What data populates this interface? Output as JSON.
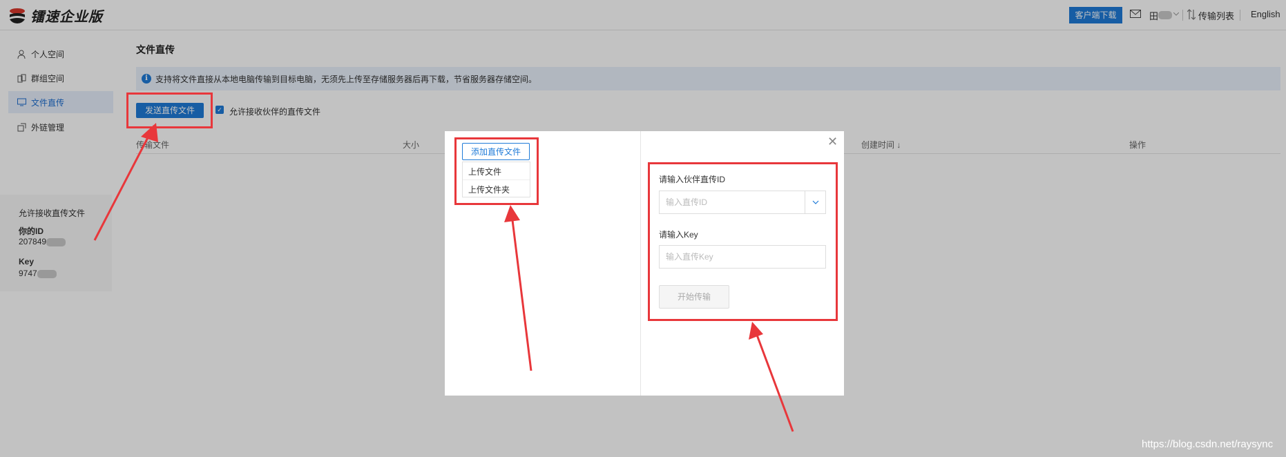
{
  "header": {
    "logo_text": "镭速企业版",
    "download_button": "客户端下载",
    "user_name": "田",
    "transfer_list": "传输列表",
    "language": "English"
  },
  "sidebar": {
    "items": [
      {
        "label": "个人空间",
        "icon": "person-icon"
      },
      {
        "label": "群组空间",
        "icon": "group-icon"
      },
      {
        "label": "文件直传",
        "icon": "monitor-icon"
      },
      {
        "label": "外链管理",
        "icon": "link-icon"
      }
    ],
    "info_title": "允许接收直传文件",
    "id_label": "你的ID",
    "id_value": "207849",
    "key_label": "Key",
    "key_value": "9747"
  },
  "main": {
    "title": "文件直传",
    "notice": "支持将文件直接从本地电脑传输到目标电脑，无须先上传至存储服务器后再下载，节省服务器存储空间。",
    "send_button": "发送直传文件",
    "allow_checkbox_label": "允许接收伙伴的直传文件",
    "allow_checked": true,
    "columns": [
      "传输文件",
      "大小",
      "创建时间 ↓",
      "操作"
    ]
  },
  "modal": {
    "add_button": "添加直传文件",
    "menu": [
      "上传文件",
      "上传文件夹"
    ],
    "partner_id_label": "请输入伙伴直传ID",
    "partner_id_placeholder": "输入直传ID",
    "key_label": "请输入Key",
    "key_placeholder": "输入直传Key",
    "start_button": "开始传输"
  },
  "watermark": "https://blog.csdn.net/raysync",
  "colors": {
    "accent": "#1f7bd8",
    "annotation": "#e8373b"
  }
}
